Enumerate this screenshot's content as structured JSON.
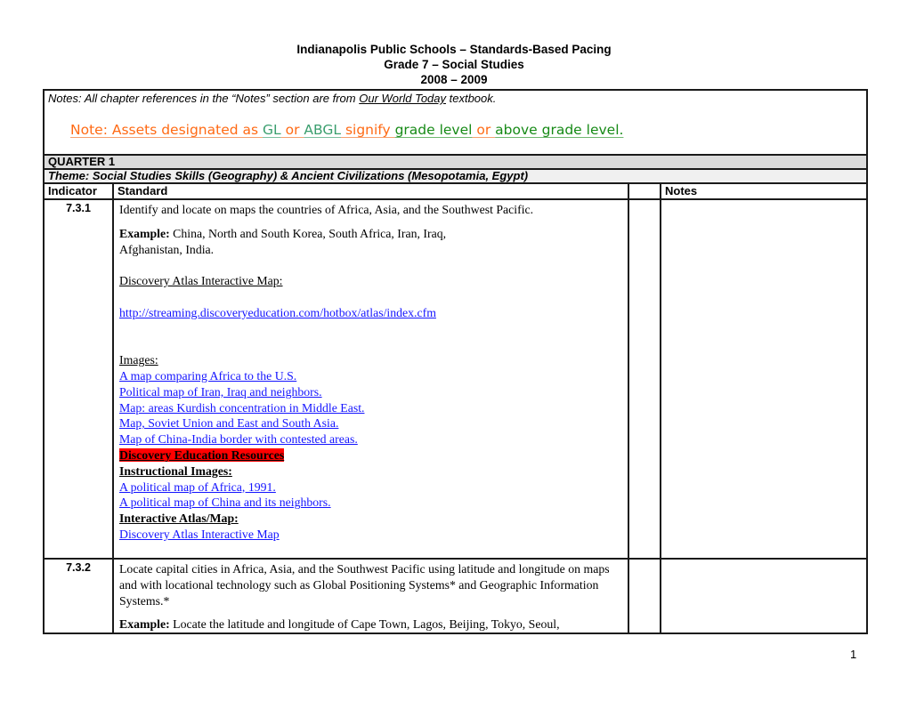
{
  "header": {
    "line1": "Indianapolis Public Schools – Standards-Based Pacing",
    "line2": "Grade 7 – Social Studies",
    "line3": "2008 – 2009"
  },
  "notes": {
    "prefix": "Notes:  All chapter references in the “Notes” section are from ",
    "textbook": "Our World Today",
    "suffix": " textbook.",
    "asset_note": {
      "part1": "Note: Assets designated as ",
      "gl": "GL",
      "or1": " or ",
      "abgl": "ABGL",
      "signify": " signify ",
      "grade_level": "grade level",
      "or2": " or ",
      "above_grade_level": "above grade level."
    }
  },
  "colors": {
    "note_orange": "#ff6a14",
    "note_teal": "#3a9e6e",
    "note_green": "#168a16",
    "link_blue": "#1414ff",
    "highlight_red": "#ff0000",
    "quarter_bg": "#dcdcdc",
    "theme_bg": "#f0f0f0"
  },
  "quarter": {
    "label": "QUARTER 1",
    "theme": "Theme: Social Studies Skills (Geography) &  Ancient Civilizations (Mesopotamia, Egypt)"
  },
  "columns": {
    "indicator": "Indicator",
    "standard": "Standard",
    "blank": "",
    "notes": "Notes"
  },
  "rows": [
    {
      "indicator": "7.3.1",
      "standard": "Identify and locate on maps the countries of Africa, Asia, and the Southwest Pacific.",
      "example_label": "Example:",
      "example_text": " China, North and South Korea, South Africa, Iran, Iraq,",
      "example_text2": "Afghanistan, India.",
      "atlas_label": "Discovery Atlas Interactive Map:",
      "atlas_url": "http://streaming.discoveryeducation.com/hotbox/atlas/index.cfm",
      "images_label": "Images:",
      "image_links": [
        "A map comparing Africa to the U.S.",
        "Political map of Iran, Iraq and neighbors.",
        "Map: areas Kurdish concentration in Middle East.",
        "Map, Soviet Union and East and South Asia.",
        "Map of China-India border with contested areas."
      ],
      "de_resources": "Discovery Education Resources",
      "instructional_images_label": "Instructional Images:",
      "instructional_links": [
        "A political map of Africa, 1991.",
        "A political map of China and its neighbors."
      ],
      "interactive_label": "Interactive Atlas/Map:",
      "interactive_link": "Discovery Atlas Interactive Map"
    },
    {
      "indicator": "7.3.2",
      "standard": "Locate capital cities in Africa, Asia, and the Southwest Pacific using latitude and longitude on maps and with locational technology such as Global Positioning Systems* and Geographic Information Systems.*",
      "example_label": "Example:",
      "example_text": " Locate the latitude and longitude of Cape Town, Lagos, Beijing, Tokyo, Seoul,"
    }
  ],
  "page_number": "1"
}
